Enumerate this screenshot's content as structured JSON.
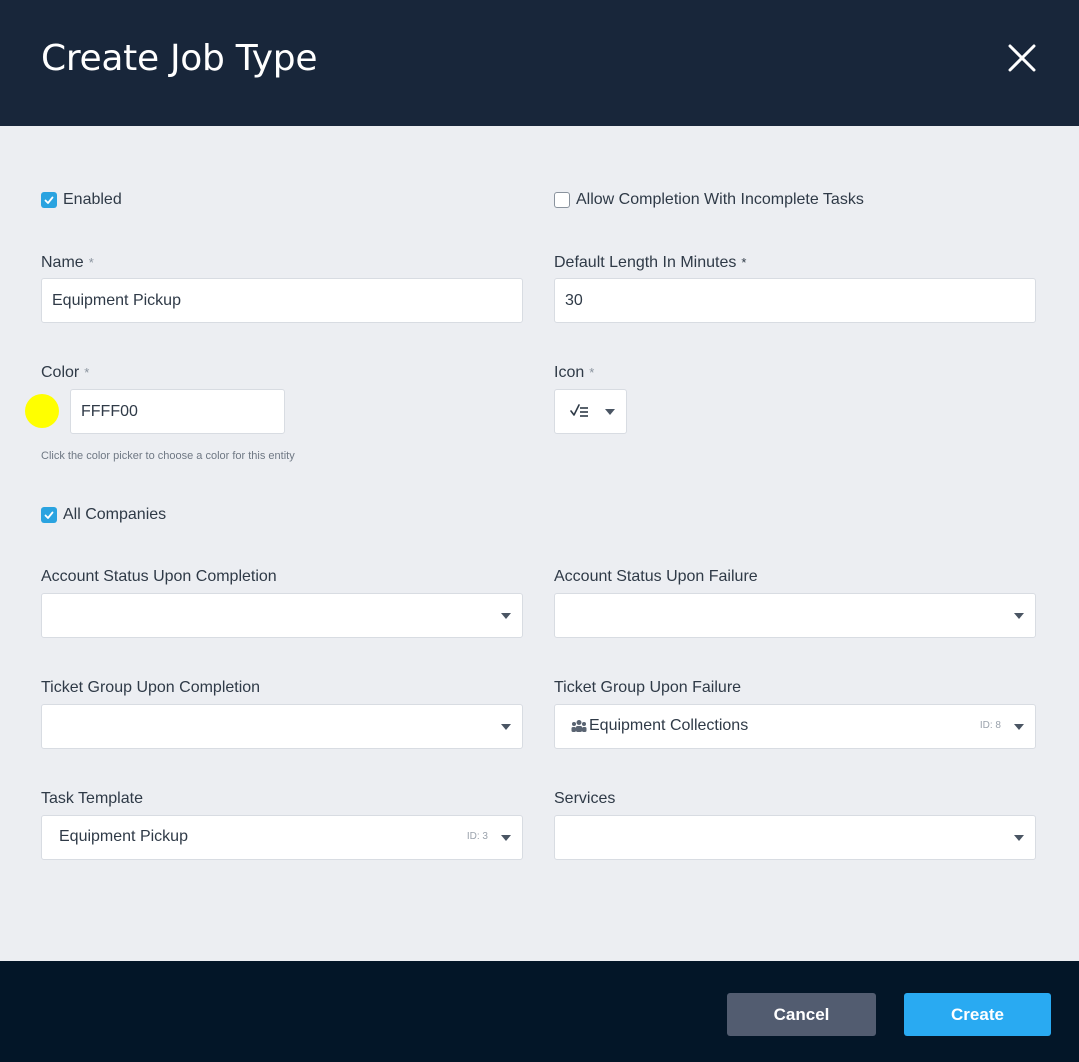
{
  "dialog": {
    "title": "Create Job Type",
    "close_icon": "close-icon"
  },
  "form": {
    "enabled": {
      "label": "Enabled",
      "checked": true
    },
    "allow_incomplete": {
      "label": "Allow Completion With Incomplete Tasks",
      "checked": false
    },
    "name": {
      "label": "Name",
      "required_mark": "*",
      "value": "Equipment Pickup"
    },
    "default_length": {
      "label": "Default Length In Minutes",
      "required_mark": "*",
      "value": "30"
    },
    "color": {
      "label": "Color",
      "required_mark": "*",
      "value": "FFFF00",
      "swatch_color": "#FFFF00",
      "help": "Click the color picker to choose a color for this entity"
    },
    "icon": {
      "label": "Icon",
      "required_mark": "*",
      "selected_icon": "tasks-checklist-icon"
    },
    "all_companies": {
      "label": "All Companies",
      "checked": true
    },
    "account_status_completion": {
      "label": "Account Status Upon Completion",
      "value": ""
    },
    "account_status_failure": {
      "label": "Account Status Upon Failure",
      "value": ""
    },
    "ticket_group_completion": {
      "label": "Ticket Group Upon Completion",
      "value": ""
    },
    "ticket_group_failure": {
      "label": "Ticket Group Upon Failure",
      "value": "Equipment Collections",
      "id": "ID: 8",
      "icon": "group-icon"
    },
    "task_template": {
      "label": "Task Template",
      "value": "Equipment Pickup",
      "id": "ID: 3"
    },
    "services": {
      "label": "Services",
      "value": ""
    }
  },
  "footer": {
    "cancel_label": "Cancel",
    "create_label": "Create"
  },
  "colors": {
    "header_bg": "#18263a",
    "footer_bg": "#031628",
    "accent": "#29aaf2",
    "cancel_bg": "#525c70"
  }
}
